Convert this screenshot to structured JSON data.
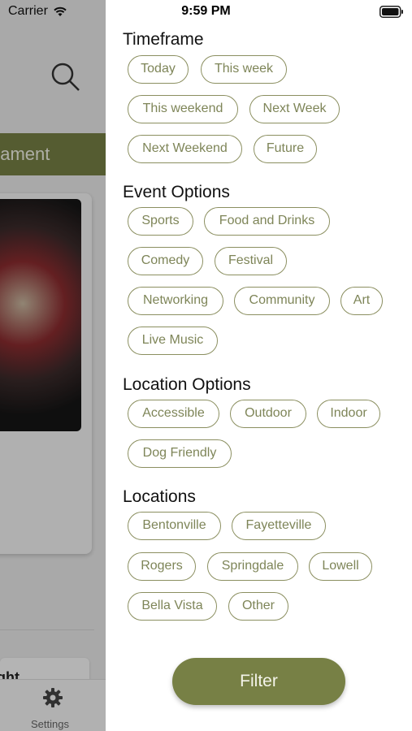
{
  "status_bar": {
    "carrier": "Carrier",
    "time": "9:59 PM"
  },
  "background_app": {
    "banner_text": "nament",
    "card2_text": "ght",
    "tab_settings_label": "Settings"
  },
  "filters": {
    "sections": [
      {
        "title": "Timeframe",
        "chips": [
          "Today",
          "This week",
          "This weekend",
          "Next Week",
          "Next Weekend",
          "Future"
        ]
      },
      {
        "title": "Event Options",
        "chips": [
          "Sports",
          "Food and Drinks",
          "Comedy",
          "Festival",
          "Networking",
          "Community",
          "Art",
          "Live Music"
        ]
      },
      {
        "title": "Location Options",
        "chips": [
          "Accessible",
          "Outdoor",
          "Indoor",
          "Dog Friendly"
        ]
      },
      {
        "title": "Locations",
        "chips": [
          "Bentonville",
          "Fayetteville",
          "Rogers",
          "Springdale",
          "Lowell",
          "Bella Vista",
          "Other"
        ]
      }
    ],
    "filter_button_label": "Filter"
  },
  "colors": {
    "accent": "#778045",
    "chip_border": "#8b8f60",
    "chip_text": "#7e8558"
  }
}
